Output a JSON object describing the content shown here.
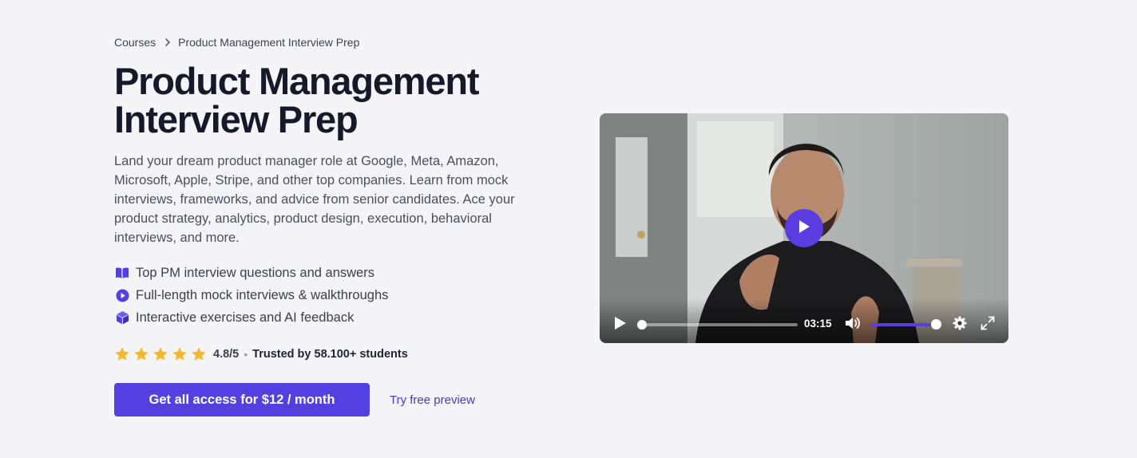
{
  "breadcrumb": {
    "root": "Courses",
    "separator_icon": "chevron-right-icon",
    "current": "Product Management Interview Prep"
  },
  "course": {
    "title_line1": "Product Management",
    "title_line2": "Interview Prep",
    "description": "Land your dream product manager role at Google, Meta, Amazon, Microsoft, Apple, Stripe, and other top companies. Learn from mock interviews, frameworks, and advice from senior candidates. Ace your product strategy, analytics, product design, execution, behavioral interviews, and more."
  },
  "features": [
    {
      "icon": "book-icon",
      "label": "Top PM interview questions and answers"
    },
    {
      "icon": "play-circle-icon",
      "label": "Full-length mock interviews & walkthroughs"
    },
    {
      "icon": "cube-icon",
      "label": "Interactive exercises and AI feedback"
    }
  ],
  "rating": {
    "stars": 5,
    "score": "4.8/5",
    "separator": "•",
    "trusted": "Trusted by 58.100+ students"
  },
  "cta": {
    "primary_label": "Get all access for $12 / month",
    "secondary_label": "Try free preview"
  },
  "video": {
    "time": "03:15",
    "progress": 0.0,
    "volume": 1.0
  },
  "colors": {
    "accent": "#5240e0",
    "link": "#4a36c9",
    "star": "#f5b82e",
    "background": "#f5f5f9",
    "title": "#141a2b"
  }
}
